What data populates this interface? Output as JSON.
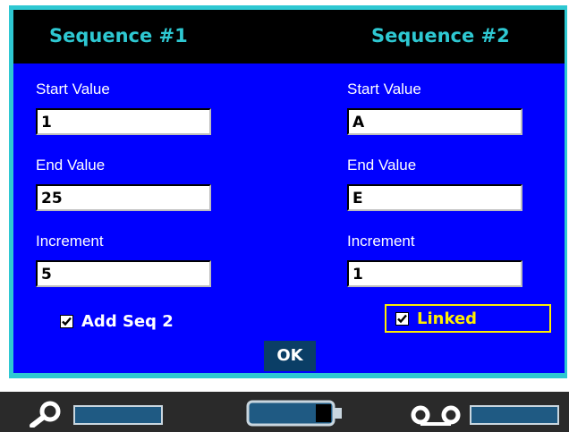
{
  "header": {
    "seq1_title": "Sequence #1",
    "seq2_title": "Sequence #2"
  },
  "sequence1": {
    "start_label": "Start Value",
    "start_value": "1",
    "end_label": "End Value",
    "end_value": "25",
    "increment_label": "Increment",
    "increment_value": "5",
    "add_seq_label": "Add Seq 2",
    "add_seq_checked": true
  },
  "sequence2": {
    "start_label": "Start Value",
    "start_value": "A",
    "end_label": "End Value",
    "end_value": "E",
    "increment_label": "Increment",
    "increment_value": "1",
    "linked_label": "Linked",
    "linked_checked": true
  },
  "ok_label": "OK",
  "status_bar": {
    "left_icon": "search-icon",
    "center_icon": "battery-icon",
    "right_icon": "tape-icon"
  },
  "colors": {
    "dialog_bg": "#0000ff",
    "frame": "#2ec8d2",
    "header_text": "#2ec8d2",
    "focus_highlight": "#ffee00",
    "ok_button": "#0a3e66"
  }
}
